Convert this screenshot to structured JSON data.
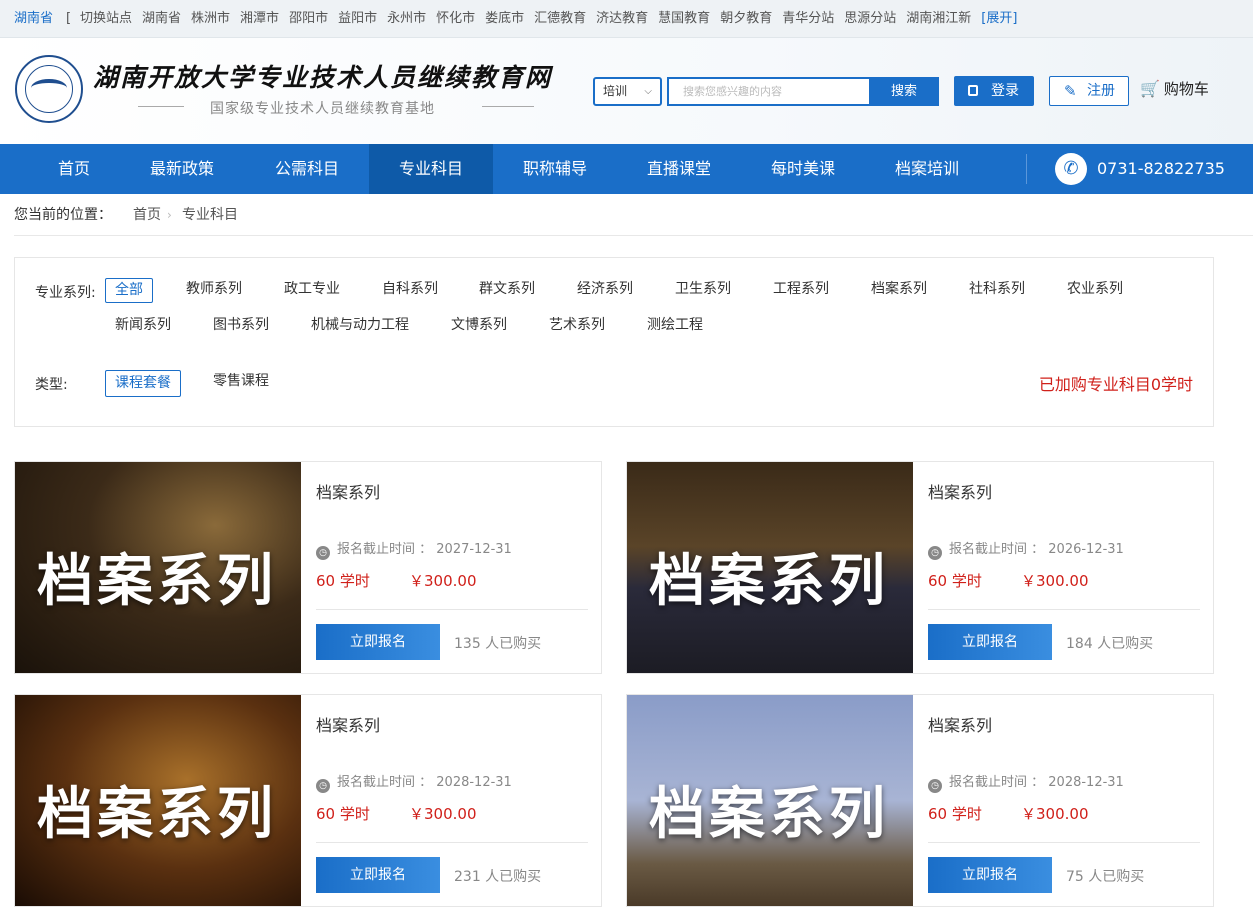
{
  "citybar": {
    "province": "湖南省",
    "bracket": "[",
    "cities": [
      "切换站点",
      "湖南省",
      "株洲市",
      "湘潭市",
      "邵阳市",
      "益阳市",
      "永州市",
      "怀化市",
      "娄底市",
      "汇德教育",
      "济达教育",
      "慧国教育",
      "朝夕教育",
      "青华分站",
      "思源分站",
      "湖南湘江新"
    ],
    "expand": "[展开]"
  },
  "header": {
    "title": "湖南开放大学专业技术人员继续教育网",
    "subtitle": "国家级专业技术人员继续教育基地",
    "search_select": "培训",
    "search_placeholder": "搜索您感兴趣的内容",
    "search_button": "搜索",
    "login": "登录",
    "register": "注册",
    "cart": "购物车"
  },
  "nav": {
    "items": [
      "首页",
      "最新政策",
      "公需科目",
      "专业科目",
      "职称辅导",
      "直播课堂",
      "每时美课",
      "档案培训"
    ],
    "active_index": 3,
    "phone": "0731-82822735"
  },
  "breadcrumb": {
    "label": "您当前的位置：",
    "home": "首页",
    "current": "专业科目"
  },
  "filter": {
    "series_label": "专业系列:",
    "series": [
      "全部",
      "教师系列",
      "政工专业",
      "自科系列",
      "群文系列",
      "经济系列",
      "卫生系列",
      "工程系列",
      "档案系列",
      "社科系列",
      "农业系列",
      "新闻系列",
      "图书系列",
      "机械与动力工程",
      "文博系列",
      "艺术系列",
      "测绘工程"
    ],
    "type_label": "类型:",
    "types": [
      "课程套餐",
      "零售课程"
    ],
    "added": "已加购专业科目0学时"
  },
  "cards": [
    {
      "image_text": "档案系列",
      "title": "档案系列",
      "deadline_label": "报名截止时间 ：",
      "deadline": "2027-12-31",
      "hours": "60  学时",
      "price": "￥300.00",
      "button": "立即报名",
      "bought": "135 人已购买"
    },
    {
      "image_text": "档案系列",
      "title": "档案系列",
      "deadline_label": "报名截止时间 ：",
      "deadline": "2026-12-31",
      "hours": "60  学时",
      "price": "￥300.00",
      "button": "立即报名",
      "bought": "184 人已购买"
    },
    {
      "image_text": "档案系列",
      "title": "档案系列",
      "deadline_label": "报名截止时间 ：",
      "deadline": "2028-12-31",
      "hours": "60  学时",
      "price": "￥300.00",
      "button": "立即报名",
      "bought": "231 人已购买"
    },
    {
      "image_text": "档案系列",
      "title": "档案系列",
      "deadline_label": "报名截止时间 ：",
      "deadline": "2028-12-31",
      "hours": "60  学时",
      "price": "￥300.00",
      "button": "立即报名",
      "bought": "75 人已购买"
    }
  ],
  "colors": {
    "brand": "#1a6ec8",
    "nav_active": "#0e5aa8",
    "price": "#d0201a"
  }
}
